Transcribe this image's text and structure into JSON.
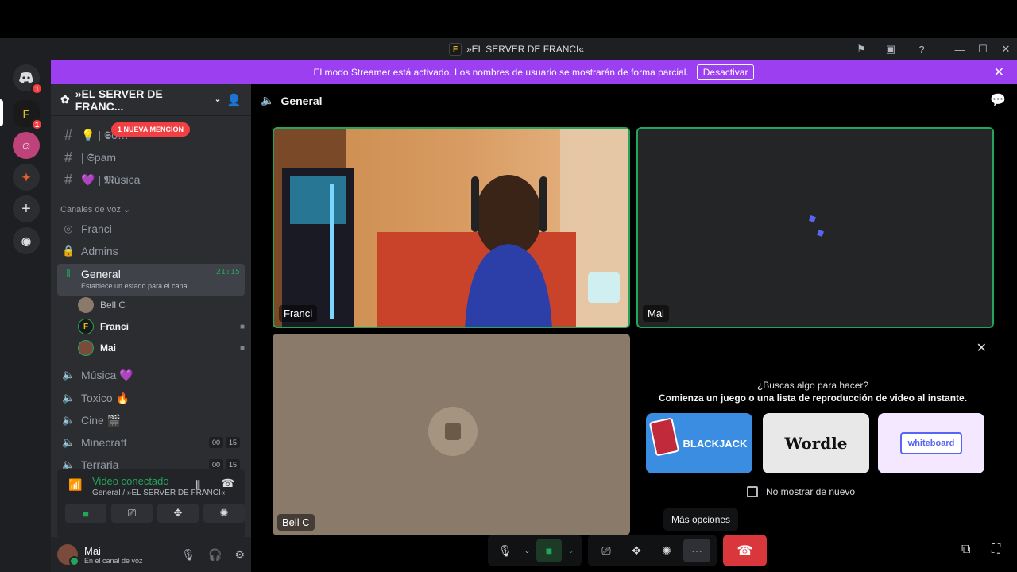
{
  "window": {
    "title": "»EL SERVER DE FRANCI«",
    "logo_letter": "F",
    "icons": [
      "flag-icon",
      "inbox-icon",
      "help-icon",
      "minimize-icon",
      "maximize-icon",
      "close-icon"
    ]
  },
  "rail": {
    "home_badge": "1",
    "server_badge": "1",
    "server_letter": "F"
  },
  "banner": {
    "text": "El modo Streamer está activado. Los nombres de usuario se mostrarán de forma parcial.",
    "button": "Desactivar"
  },
  "server": {
    "name": "»EL SERVER DE FRANC...",
    "mention_pill": "1 NUEVA MENCIÓN",
    "text_channels": [
      {
        "name": "💡 | 𝕾o…"
      },
      {
        "name": "| 𝕾pam"
      },
      {
        "name": "💜 | 𝕸úsica"
      }
    ],
    "voice_category": "Canales de voz",
    "voice_channels": [
      {
        "name": "Franci"
      },
      {
        "name": "Admins"
      }
    ],
    "active_channel": {
      "name": "General",
      "status": "Establece un estado para el canal",
      "time": "21:15"
    },
    "voice_users": [
      {
        "name": "Bell C"
      },
      {
        "name": "Franci"
      },
      {
        "name": "Mai"
      }
    ],
    "more_voice_channels": [
      {
        "name": "Música 💜",
        "badges": []
      },
      {
        "name": "Toxico 🔥",
        "badges": []
      },
      {
        "name": "Cine 🎬",
        "badges": []
      },
      {
        "name": "Minecraft",
        "badges": [
          "00",
          "15"
        ]
      },
      {
        "name": "Terraria",
        "badges": [
          "00",
          "15"
        ]
      }
    ]
  },
  "voice_panel": {
    "status": "Video conectado",
    "sub": "General / »EL SERVER DE FRANCI«"
  },
  "user": {
    "name": "Mai",
    "status": "En el canal de voz"
  },
  "main": {
    "channel": "General",
    "tiles": [
      {
        "name": "Franci"
      },
      {
        "name": "Mai"
      },
      {
        "name": "Bell C"
      }
    ],
    "activity": {
      "question": "¿Buscas algo para hacer?",
      "prompt": "Comienza un juego o una lista de reproducción de video al instante.",
      "cards": [
        "BLACKJACK",
        "Wordle",
        "whiteboard"
      ],
      "checkbox": "No mostrar de nuevo"
    },
    "tooltip": "Más opciones"
  },
  "colors": {
    "accent": "#9c3ff0",
    "green": "#23a55a",
    "red": "#da373c"
  }
}
